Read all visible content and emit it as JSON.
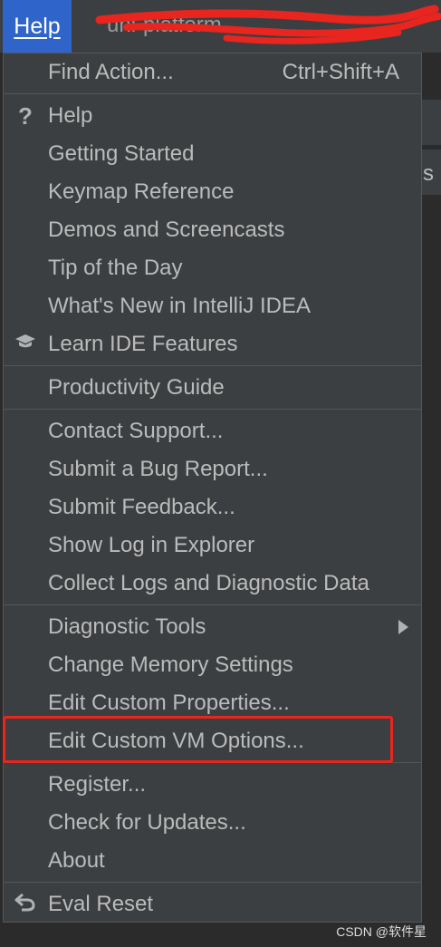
{
  "menubar": {
    "help_label": "Help",
    "title_fragment": "uni-platform"
  },
  "background": {
    "edge_letter": "s"
  },
  "menu": {
    "find_action": {
      "label": "Find Action...",
      "shortcut": "Ctrl+Shift+A"
    },
    "help": "Help",
    "getting_started": "Getting Started",
    "keymap_reference": "Keymap Reference",
    "demos": "Demos and Screencasts",
    "tip_of_day": "Tip of the Day",
    "whats_new": "What's New in IntelliJ IDEA",
    "learn_ide": "Learn IDE Features",
    "productivity_guide": "Productivity Guide",
    "contact_support": "Contact Support...",
    "submit_bug": "Submit a Bug Report...",
    "submit_feedback": "Submit Feedback...",
    "show_log": "Show Log in Explorer",
    "collect_logs": "Collect Logs and Diagnostic Data",
    "diagnostic_tools": "Diagnostic Tools",
    "change_memory": "Change Memory Settings",
    "edit_properties": "Edit Custom Properties...",
    "edit_vm_options": "Edit Custom VM Options...",
    "register": "Register...",
    "check_updates": "Check for Updates...",
    "about": "About",
    "eval_reset": "Eval Reset"
  },
  "icons": {
    "help": "question-icon",
    "learn": "graduation-cap-icon",
    "eval_reset": "undo-icon",
    "submenu": "submenu-arrow-icon"
  },
  "colors": {
    "menu_bg": "#3c3f41",
    "selected_menu": "#2f65ca",
    "annotation_red": "#e8251e"
  },
  "watermark": "CSDN @软件星"
}
